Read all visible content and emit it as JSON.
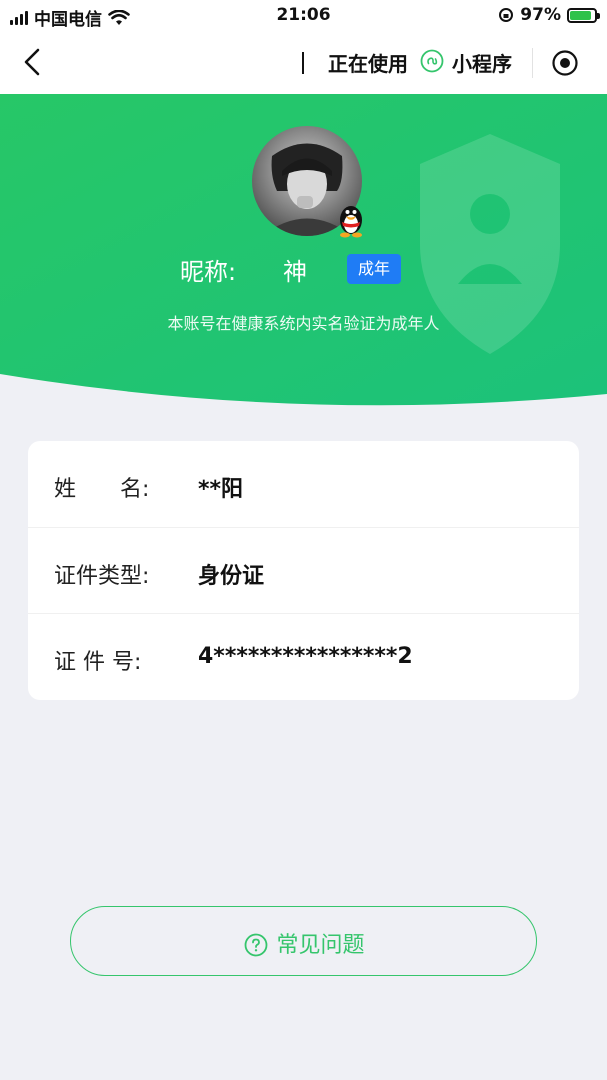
{
  "status_bar": {
    "carrier": "中国电信",
    "time": "21:06",
    "battery": "97%",
    "battery_level": 0.97,
    "battery_color": "#2fc24a"
  },
  "nav": {
    "using_label": "正在使用",
    "miniprogram_label": "小程序",
    "icons": [
      "back-chevron-icon",
      "miniprogram-link-icon",
      "record-target-icon"
    ]
  },
  "profile": {
    "nickname_label": "昵称:",
    "nickname": "神",
    "age_badge": "成年",
    "verify_text": "本账号在健康系统内实名验证为成年人",
    "accent_color": "#2ed173",
    "badge_color": "#1f7cf5"
  },
  "info": {
    "rows": [
      {
        "label": "姓　　名:",
        "value": "**阳"
      },
      {
        "label": "证件类型:",
        "value": "身份证"
      },
      {
        "label": "证 件 号:",
        "value": "4****************2"
      }
    ]
  },
  "faq": {
    "label": "常见问题",
    "icon": "question-circle-icon"
  }
}
